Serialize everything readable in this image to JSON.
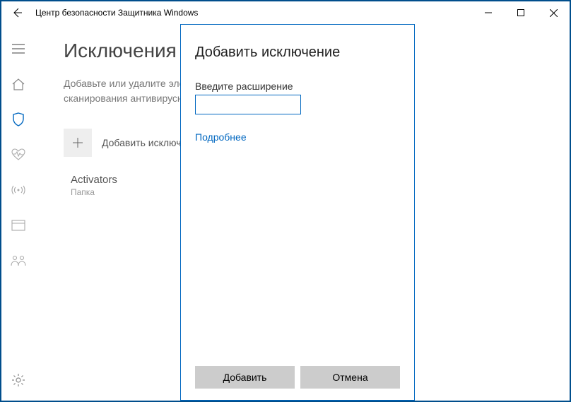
{
  "window": {
    "title": "Центр безопасности Защитника Windows"
  },
  "page": {
    "heading": "Исключения",
    "description": "Добавьте или удалите элементы, которые хотите исключить из списка сканирования антивирусной программы \"Защитник Windows\".",
    "add_label": "Добавить исключение"
  },
  "exclusion": {
    "name": "Activators",
    "type": "Папка"
  },
  "dialog": {
    "title": "Добавить исключение",
    "field_label": "Введите расширение",
    "input_value": "",
    "more_link": "Подробнее",
    "add_button": "Добавить",
    "cancel_button": "Отмена"
  }
}
